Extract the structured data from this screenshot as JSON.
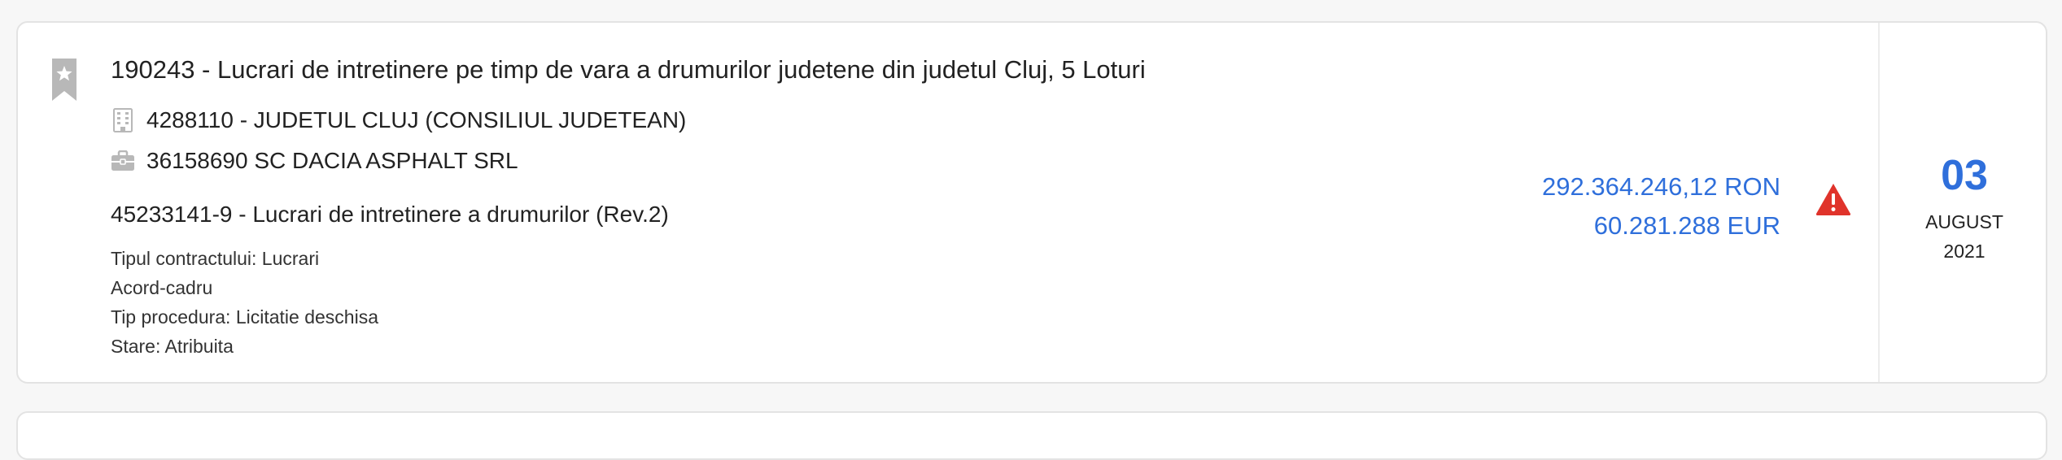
{
  "tender": {
    "title": "190243 - Lucrari de intretinere pe timp de vara a drumurilor judetene din judetul Cluj, 5 Loturi",
    "authority": "4288110 - JUDETUL CLUJ (CONSILIUL JUDETEAN)",
    "supplier": "36158690 SC DACIA ASPHALT SRL",
    "cpv": "45233141-9 - Lucrari de intretinere a drumurilor (Rev.2)",
    "details": {
      "contract_type": "Tipul contractului: Lucrari",
      "framework": "Acord-cadru",
      "procedure": "Tip procedura: Licitatie deschisa",
      "status": "Stare: Atribuita"
    },
    "value_ron": "292.364.246,12 RON",
    "value_eur": "60.281.288 EUR",
    "date": {
      "day": "03",
      "month": "AUGUST",
      "year": "2021"
    }
  },
  "icons": {
    "bookmark": "bookmark-star-icon",
    "authority": "building-icon",
    "supplier": "briefcase-icon",
    "warning": "warning-icon"
  },
  "colors": {
    "accent": "#2f6fdb",
    "warning": "#e0332b",
    "icon_gray": "#b8b8b8"
  }
}
